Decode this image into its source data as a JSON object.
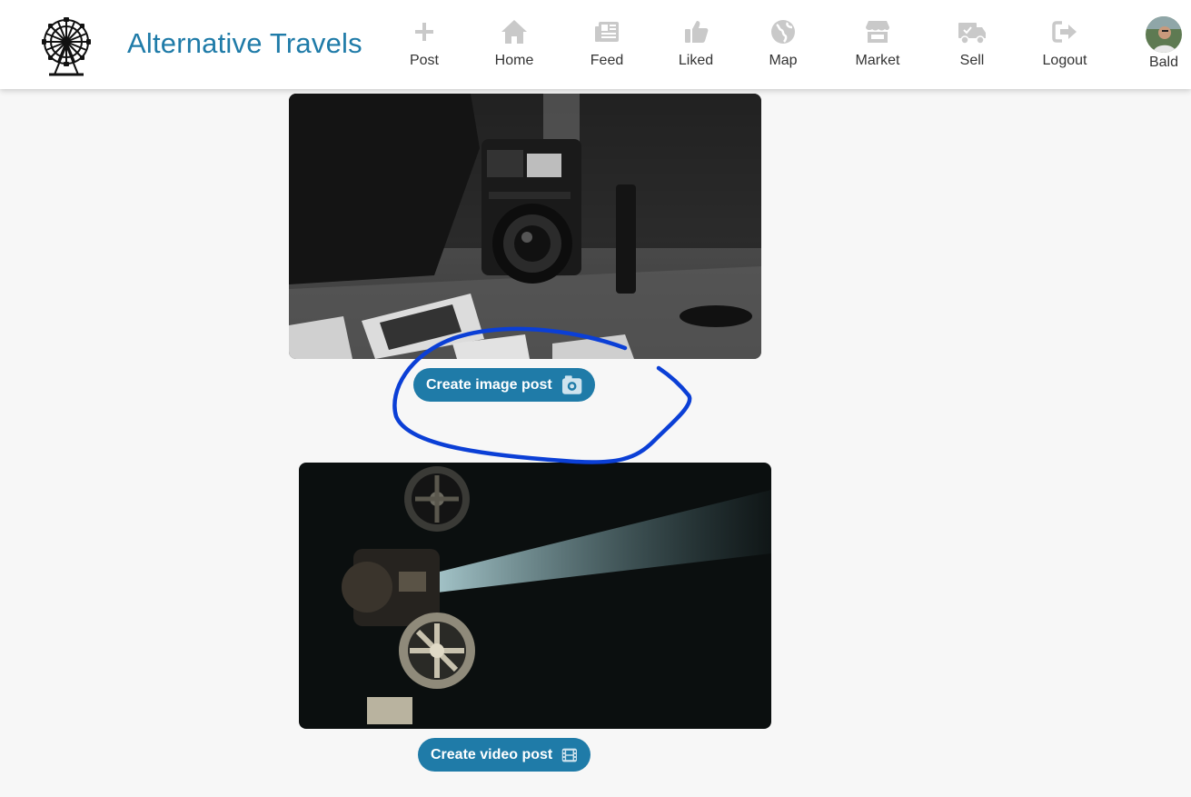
{
  "header": {
    "brand": "Alternative Travels",
    "nav": [
      {
        "label": "Post",
        "icon": "plus-icon"
      },
      {
        "label": "Home",
        "icon": "home-icon"
      },
      {
        "label": "Feed",
        "icon": "newspaper-icon"
      },
      {
        "label": "Liked",
        "icon": "thumbs-up-icon"
      },
      {
        "label": "Map",
        "icon": "globe-icon"
      },
      {
        "label": "Market",
        "icon": "store-icon"
      },
      {
        "label": "Sell",
        "icon": "truck-icon"
      },
      {
        "label": "Logout",
        "icon": "sign-out-icon"
      }
    ],
    "user": {
      "name": "Bald"
    }
  },
  "main": {
    "image_post_button": "Create image post",
    "video_post_button": "Create video post"
  },
  "colors": {
    "brand": "#1f7ba8",
    "nav_icon": "#c9c9c9",
    "annotation": "#0b3fd6",
    "background": "#f7f7f7"
  }
}
